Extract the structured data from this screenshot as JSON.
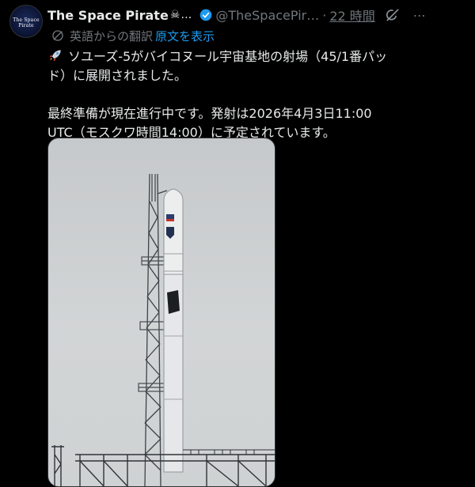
{
  "post": {
    "avatar_text": "The Space Pirate",
    "display_name": "The Space Pirate",
    "skull": "☠",
    "name_ellipsis": "…",
    "handle": "@TheSpacePir…",
    "separator": "·",
    "time": "22 時間",
    "more": "⋯",
    "translation_label": "英語からの翻訳",
    "show_original": "原文を表示",
    "text_lines": [
      "ソユーズ-5がバイコヌール宇宙基地の射場（45/1番パッ",
      "ド）に展開されました。",
      "",
      "最終準備が現在進行中です。発射は2026年4月3日11:00",
      "UTC（モスクワ時間14:00）に予定されています。"
    ]
  },
  "icons": {
    "verified": "verified-badge-icon",
    "grok": "grok-icon",
    "globe": "globe-icon",
    "rocket": "rocket-emoji-icon",
    "more": "more-icon"
  },
  "colors": {
    "background": "#000000",
    "text": "#e7e9ea",
    "muted": "#71767b",
    "link": "#1d9bf0",
    "verified": "#1d9bf0"
  }
}
